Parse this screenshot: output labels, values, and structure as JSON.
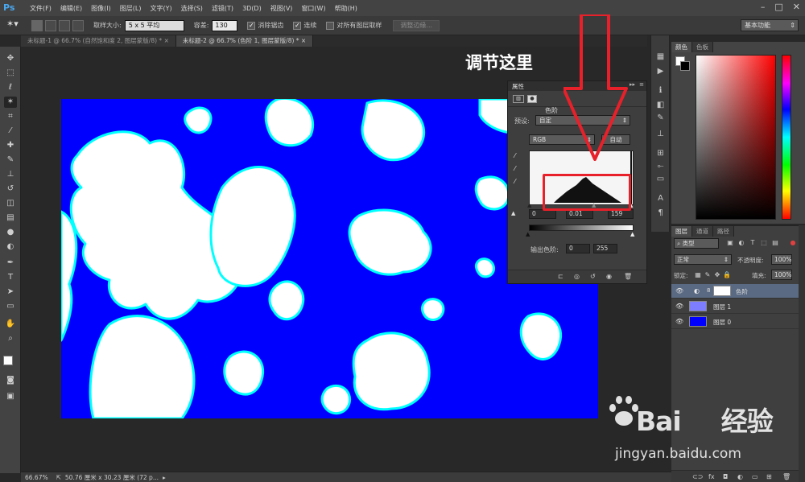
{
  "app": {
    "logo": "Ps"
  },
  "menu": [
    "文件(F)",
    "编辑(E)",
    "图像(I)",
    "图层(L)",
    "文字(Y)",
    "选择(S)",
    "滤镜(T)",
    "3D(D)",
    "视图(V)",
    "窗口(W)",
    "帮助(H)"
  ],
  "window_controls": [
    "minimize-icon",
    "maximize-icon",
    "close-icon"
  ],
  "options_bar": {
    "tool_icon": "magic-wand-icon",
    "sample_size_label": "取样大小:",
    "sample_size_value": "5 x 5 平均",
    "tolerance_label": "容差:",
    "tolerance_value": "130",
    "antialias_label": "消除锯齿",
    "antialias_checked": true,
    "contiguous_label": "连续",
    "contiguous_checked": true,
    "sample_all_label": "对所有图层取样",
    "sample_all_checked": false,
    "refine_edge_label": "调整边缘...",
    "workspace": "基本功能"
  },
  "doc_tabs": [
    {
      "label": "未标题-1 @ 66.7% (自然饱和度 2, 图层蒙版/8) *",
      "active": false
    },
    {
      "label": "未标题-2 @ 66.7% (色阶 1, 图层蒙版/8) *",
      "active": true
    }
  ],
  "annotation": {
    "title": "调节这里",
    "accent": "#e8202a"
  },
  "properties_panel": {
    "title": "属性",
    "type_label": "色阶",
    "preset_label": "预设:",
    "preset_value": "自定",
    "channel_value": "RGB",
    "auto_label": "自动",
    "input_black": "0",
    "input_gamma": "0.01",
    "input_white": "159",
    "output_label": "输出色阶:",
    "output_black": "0",
    "output_white": "255"
  },
  "color_panel": {
    "tabs": [
      "颜色",
      "色板"
    ],
    "foreground": "#ffffff",
    "background": "#000000"
  },
  "layers_panel": {
    "tabs": [
      "图层",
      "通道",
      "路径"
    ],
    "filter_value": "类型",
    "blend_mode": "正常",
    "opacity_label": "不透明度:",
    "opacity_value": "100%",
    "lock_label": "锁定:",
    "fill_label": "填充:",
    "fill_value": "100%",
    "layers": [
      {
        "name": "色阶",
        "selected": true,
        "thumb": "#ffffff"
      },
      {
        "name": "图层 1",
        "selected": false,
        "thumb": "#8a8aff"
      },
      {
        "name": "图层 0",
        "selected": false,
        "thumb": "#0000ff"
      }
    ]
  },
  "status_bar": {
    "zoom": "66.67%",
    "doc_info": "50.76 厘米 x 30.23 厘米 (72 p..."
  },
  "watermark": {
    "brand": "Bai",
    "brand_suffix": "经验",
    "url": "jingyan.baidu.com"
  },
  "image": {
    "sky_color": "#0000ff",
    "cloud_color": "#ffffff",
    "edge_color": "#00ffff"
  }
}
